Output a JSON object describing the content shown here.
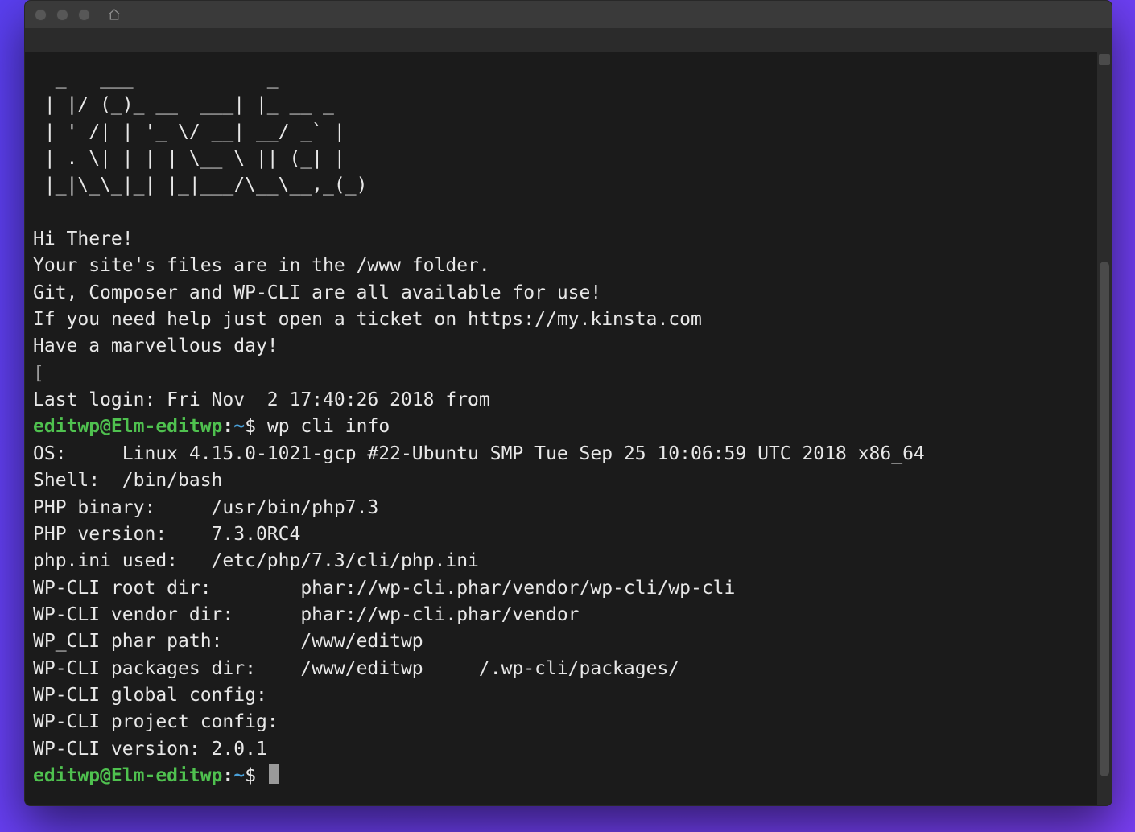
{
  "ascii_art": "  _   ___            _\n | |/ (_)_ __  ___| |_ __ _\n | ' /| | '_ \\/ __| __/ _` |\n | . \\| | | | \\__ \\ || (_| |\n |_|\\_\\_|_| |_|___/\\__\\__,_(_)",
  "greeting": {
    "l1": "Hi There!",
    "l2": "Your site's files are in the /www folder.",
    "l3": "Git, Composer and WP-CLI are all available for use!",
    "l4": "If you need help just open a ticket on https://my.kinsta.com",
    "l5": "Have a marvellous day!"
  },
  "bracket_open": "[",
  "bracket_close": "]",
  "last_login": "Last login: Fri Nov  2 17:40:26 2018 from",
  "prompt": {
    "user_host": "editwp@Elm-editwp",
    "colon": ":",
    "path": "~",
    "dollar": "$"
  },
  "command": "wp cli info",
  "output": {
    "os": "OS:     Linux 4.15.0-1021-gcp #22-Ubuntu SMP Tue Sep 25 10:06:59 UTC 2018 x86_64",
    "shell": "Shell:  /bin/bash",
    "php_binary": "PHP binary:     /usr/bin/php7.3",
    "php_version": "PHP version:    7.3.0RC4",
    "php_ini": "php.ini used:   /etc/php/7.3/cli/php.ini",
    "root_dir": "WP-CLI root dir:        phar://wp-cli.phar/vendor/wp-cli/wp-cli",
    "vendor_dir": "WP-CLI vendor dir:      phar://wp-cli.phar/vendor",
    "phar_path": "WP_CLI phar path:       /www/editwp",
    "packages_dir": "WP-CLI packages dir:    /www/editwp     /.wp-cli/packages/",
    "global_config": "WP-CLI global config:",
    "project_config": "WP-CLI project config:",
    "version": "WP-CLI version: 2.0.1"
  }
}
